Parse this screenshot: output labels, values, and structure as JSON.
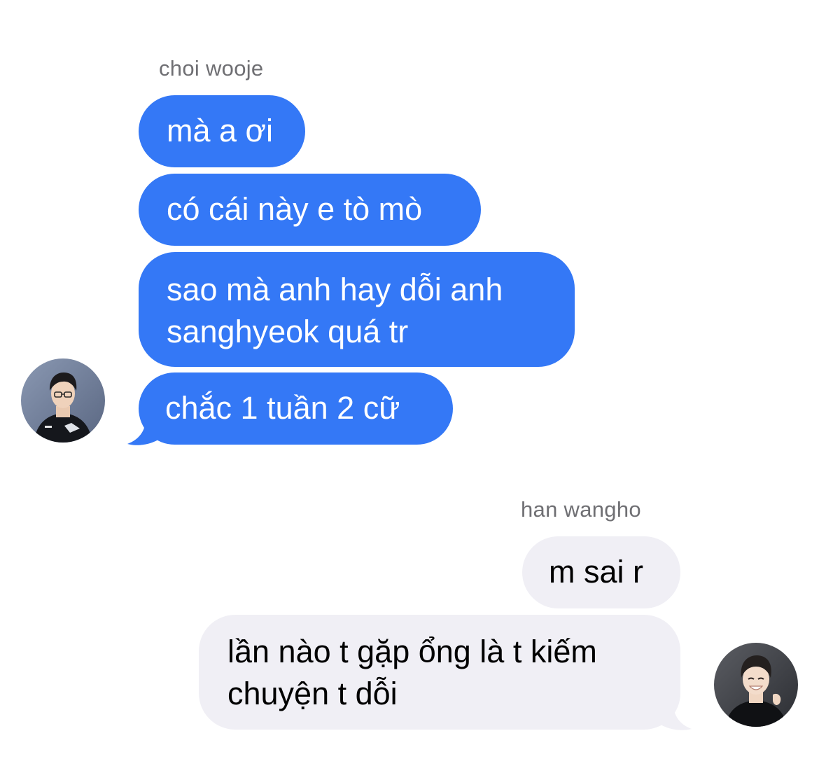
{
  "colors": {
    "incoming_bubble": "#3478f6",
    "outgoing_bubble": "#f0eff5",
    "sender_name": "#6f6f73"
  },
  "thread": {
    "group_left": {
      "sender": "choi wooje",
      "avatar_icon": "person-photo-avatar",
      "messages": [
        {
          "lines": [
            "mà a ơi"
          ]
        },
        {
          "lines": [
            "có cái này e tò mò"
          ]
        },
        {
          "lines": [
            "sao mà anh hay dỗi anh",
            "sanghyeok quá tr"
          ]
        },
        {
          "lines": [
            "chắc 1 tuần 2 cữ"
          ]
        }
      ]
    },
    "group_right": {
      "sender": "han wangho",
      "avatar_icon": "person-photo-avatar",
      "messages": [
        {
          "lines": [
            "m sai r"
          ]
        },
        {
          "lines": [
            "lần nào t gặp ổng là t kiếm",
            "chuyện t dỗi"
          ]
        }
      ]
    }
  }
}
